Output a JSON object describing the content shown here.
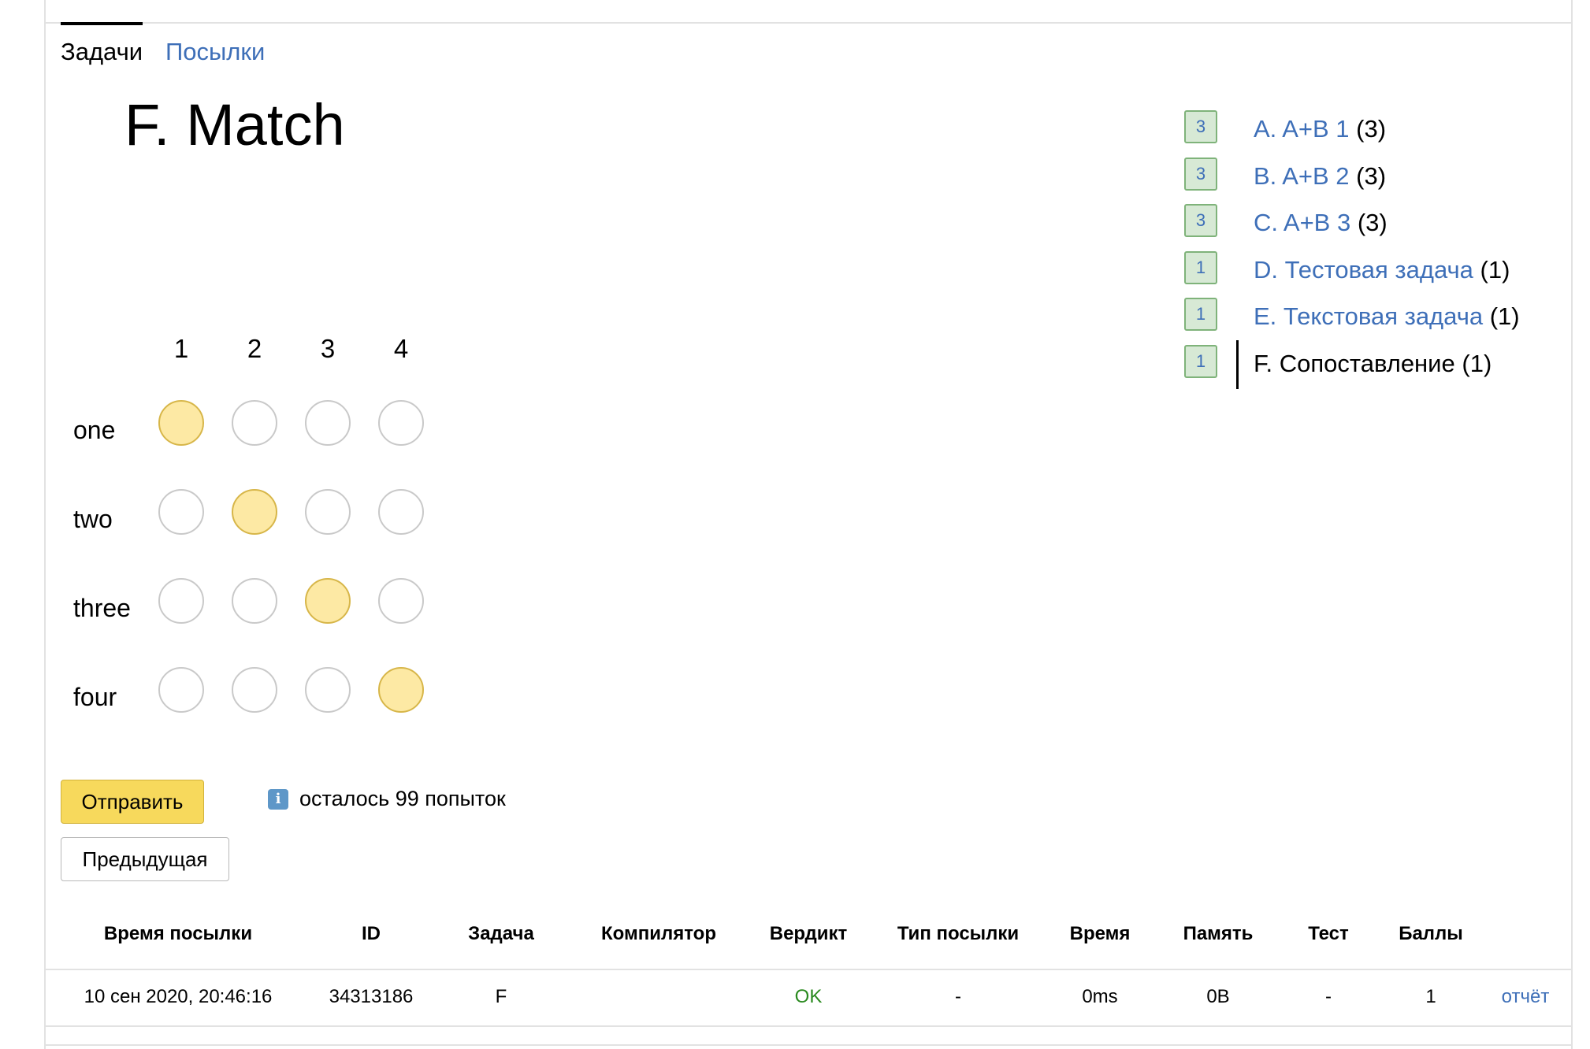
{
  "tabs": [
    {
      "label": "Задачи",
      "active": true
    },
    {
      "label": "Посылки",
      "active": false
    }
  ],
  "problem": {
    "title": "F. Match",
    "columns": [
      "1",
      "2",
      "3",
      "4"
    ],
    "rows": [
      {
        "label": "one",
        "selected": 1
      },
      {
        "label": "two",
        "selected": 2
      },
      {
        "label": "three",
        "selected": 3
      },
      {
        "label": "four",
        "selected": 4
      }
    ]
  },
  "actions": {
    "submit_label": "Отправить",
    "previous_label": "Предыдущая",
    "attempts_text": "осталось 99 попыток",
    "info_glyph": "i"
  },
  "problem_list": [
    {
      "badge": "3",
      "name": "A. A+B 1",
      "score": "(3)",
      "current": false
    },
    {
      "badge": "3",
      "name": "B. A+B 2",
      "score": "(3)",
      "current": false
    },
    {
      "badge": "3",
      "name": "C. A+B 3",
      "score": "(3)",
      "current": false
    },
    {
      "badge": "1",
      "name": "D. Тестовая задача",
      "score": "(1)",
      "current": false
    },
    {
      "badge": "1",
      "name": "E. Текстовая задача",
      "score": "(1)",
      "current": false
    },
    {
      "badge": "1",
      "name": "F. Сопоставление",
      "score": "(1)",
      "current": true
    }
  ],
  "submissions": {
    "headers": [
      "Время посылки",
      "ID",
      "Задача",
      "Компилятор",
      "Вердикт",
      "Тип посылки",
      "Время",
      "Память",
      "Тест",
      "Баллы"
    ],
    "rows": [
      {
        "time": "10 сен 2020, 20:46:16",
        "id": "34313186",
        "task": "F",
        "compiler": "",
        "verdict": "OK",
        "type": "-",
        "runtime": "0ms",
        "memory": "0B",
        "test": "-",
        "score": "1",
        "report_label": "отчёт"
      }
    ]
  },
  "colors": {
    "link": "#3e6fb8",
    "selected_fill": "#fde9a4",
    "submit_bg": "#f7d95c",
    "badge_bg": "#d7e9d5",
    "verdict_ok": "#2a8a1f"
  }
}
